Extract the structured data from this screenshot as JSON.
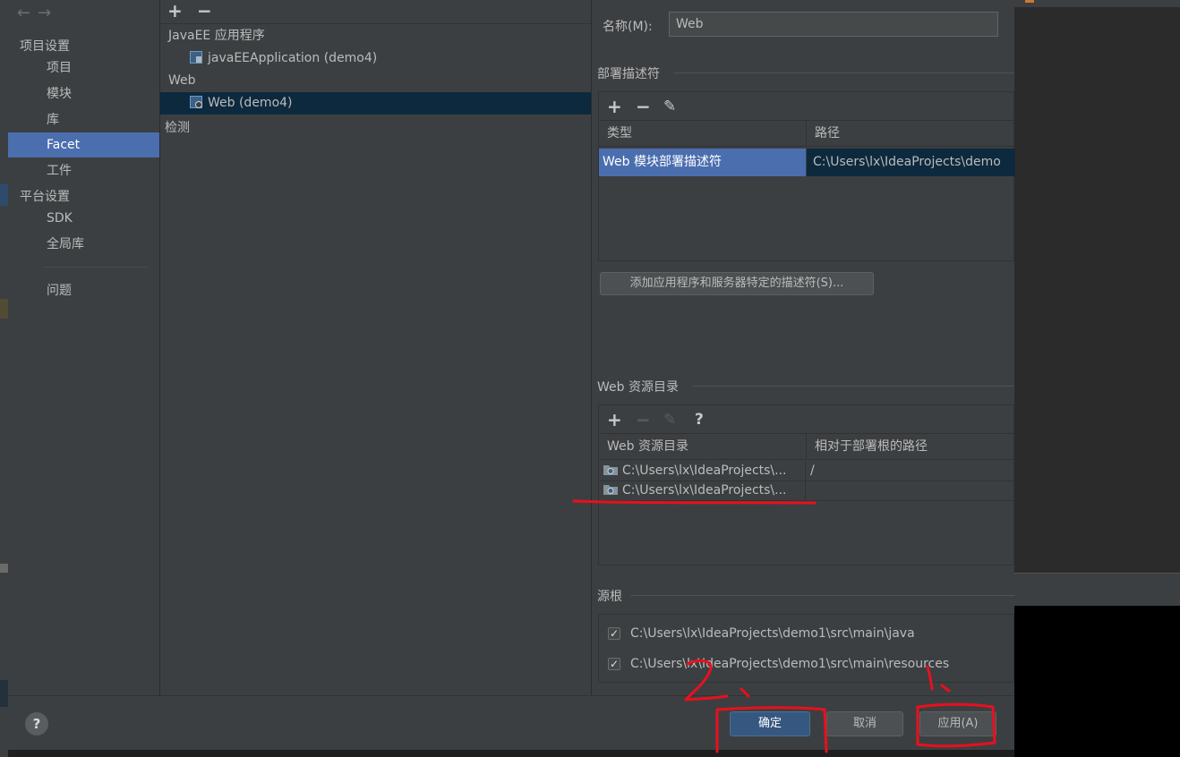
{
  "nav": {
    "back_arrow": "←",
    "forward_arrow": "→",
    "section_project": "项目设置",
    "section_platform": "平台设置",
    "items": {
      "project": "项目",
      "modules": "模块",
      "libraries": "库",
      "facets": "Facet",
      "artifacts": "工件",
      "sdk": "SDK",
      "global_libraries": "全局库",
      "problems": "问题"
    }
  },
  "tree": {
    "toolbar": {
      "add": "+",
      "remove": "−"
    },
    "nodes": [
      {
        "label": "JavaEE 应用程序",
        "type": "group"
      },
      {
        "label": "javaEEApplication (demo4)",
        "type": "facet"
      },
      {
        "label": "Web",
        "type": "group"
      },
      {
        "label": "Web (demo4)",
        "type": "facet",
        "selected": true
      },
      {
        "label": "检测",
        "type": "group"
      }
    ]
  },
  "detail": {
    "name_label": "名称(M):",
    "name_value": "Web",
    "deploy_section": "部署描述符",
    "deploy_toolbar": {
      "add": "+",
      "remove": "−",
      "edit": "✎"
    },
    "deploy_columns": [
      "类型",
      "路径"
    ],
    "deploy_rows": [
      {
        "type": "Web 模块部署描述符",
        "path": "C:\\Users\\lx\\IdeaProjects\\demo"
      }
    ],
    "add_descriptor_button": "添加应用程序和服务器特定的描述符(S)...",
    "resource_section": "Web 资源目录",
    "resource_toolbar": {
      "add": "+",
      "remove": "−",
      "edit": "✎",
      "help": "?"
    },
    "resource_columns": [
      "Web 资源目录",
      "相对于部署根的路径"
    ],
    "resource_rows": [
      {
        "dir": "C:\\Users\\lx\\IdeaProjects\\...",
        "rel": "/"
      },
      {
        "dir": "C:\\Users\\lx\\IdeaProjects\\...",
        "rel": ""
      }
    ],
    "source_section": "源根",
    "source_roots": [
      {
        "path": "C:\\Users\\lx\\IdeaProjects\\demo1\\src\\main\\java",
        "checked": true
      },
      {
        "path": "C:\\Users\\lx\\IdeaProjects\\demo1\\src\\main\\resources",
        "checked": true
      }
    ]
  },
  "footer": {
    "help": "?",
    "ok": "确定",
    "cancel": "取消",
    "apply": "应用(A)"
  },
  "colors": {
    "dialog_bg": "#3c3f41",
    "selection_blue": "#4b6eaf",
    "tree_selection": "#0d293e",
    "primary_button": "#365880",
    "annotation_red": "#e8101e"
  }
}
